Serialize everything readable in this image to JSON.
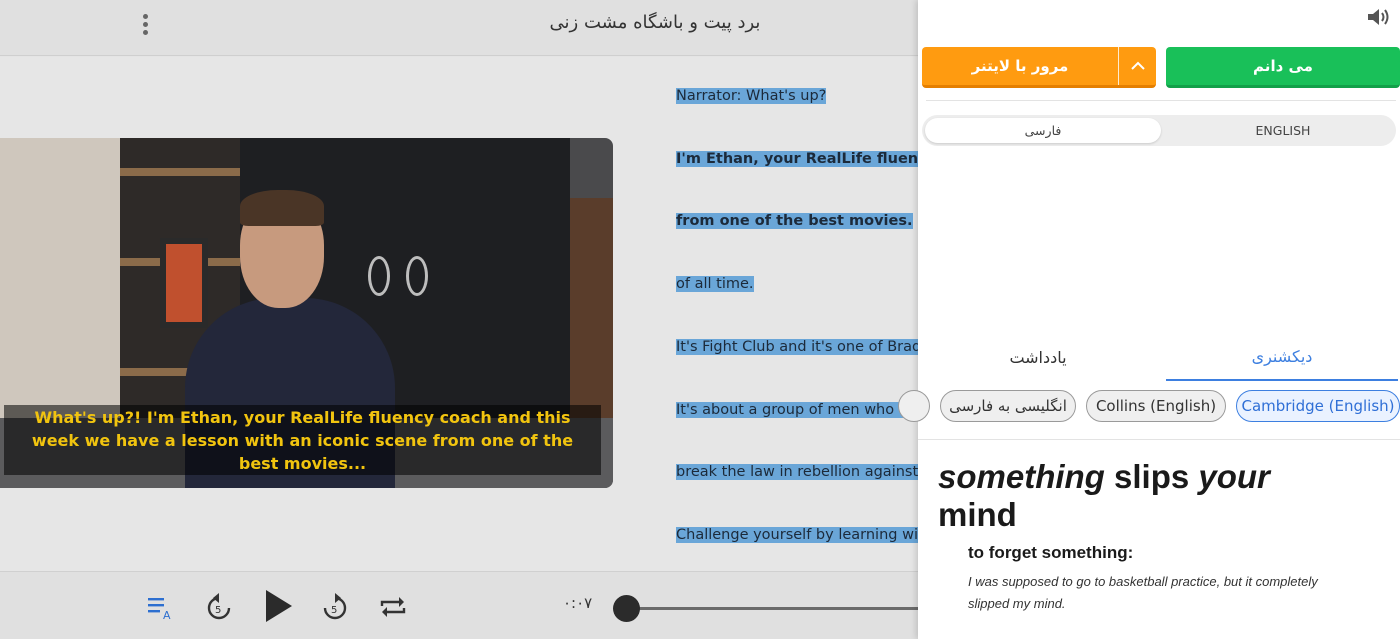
{
  "header": {
    "title": "برد پیت و باشگاه مشت زنی",
    "menu_icon": "kebab-menu-icon"
  },
  "video": {
    "subtitle": "What's up?! I'm Ethan, your RealLife fluency coach and this week we have a lesson with an iconic scene from one of the best movies..."
  },
  "transcript": {
    "lines": [
      "Narrator: What's up?",
      "I'm Ethan, your RealLife fluency co",
      "from one of the best movies.",
      "of all time.",
      "It's Fight Club and it's one of Brad",
      "It's about a group of men who figh",
      "break the law in rebellion against",
      "Challenge yourself by learning wit"
    ]
  },
  "player": {
    "time": "۰:۰۷",
    "progress": 0,
    "icons": [
      "subtitle-toggle-icon",
      "rewind-5-icon",
      "play-icon",
      "forward-5-icon",
      "repeat-icon"
    ]
  },
  "panel": {
    "speaker_icon": "speaker-icon",
    "know_button": "می دانم",
    "review_button": "مرور با لایتنر",
    "languages": {
      "english": "ENGLISH",
      "farsi": "فارسی",
      "selected": "farsi"
    },
    "tabs": {
      "dictionary": "دیکشنری",
      "notes": "یادداشت",
      "active": "dictionary"
    },
    "dictionaries": [
      {
        "label": "Cambridge (English)",
        "active": true
      },
      {
        "label": "Collins (English)",
        "active": false
      },
      {
        "label": "انگلیسی به فارسی",
        "active": false
      }
    ],
    "entry": {
      "w1": "something",
      "w2": "slips",
      "w3": "your",
      "w4": "mind",
      "definition": "to forget something:",
      "example": "I was supposed to go to basketball practice, but it completely slipped my mind."
    }
  },
  "colors": {
    "know": "#19c059",
    "review": "#ff9b10",
    "accent": "#3d7fe0",
    "subtitle": "#f1c40f",
    "highlight": "#6aa6d8"
  }
}
